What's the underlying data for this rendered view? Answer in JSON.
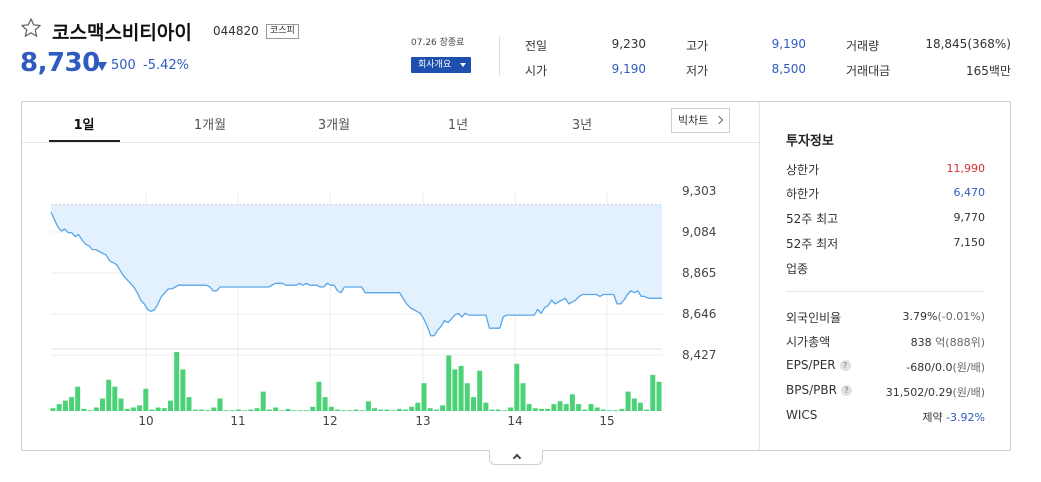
{
  "header": {
    "name": "코스맥스비티아이",
    "code": "044820",
    "market": "코스피",
    "price": "8,730",
    "change": "500",
    "change_pct": "-5.42%",
    "close_label": "07.26 장종료",
    "company_button": "회사개요"
  },
  "quote": {
    "prev_label": "전일",
    "prev_value": "9,230",
    "open_label": "시가",
    "open_value": "9,190",
    "high_label": "고가",
    "high_value": "9,190",
    "low_label": "저가",
    "low_value": "8,500",
    "volume_label": "거래량",
    "volume_value": "18,845(368%)",
    "amount_label": "거래대금",
    "amount_value": "165백만"
  },
  "tabs": [
    "1일",
    "1개월",
    "3개월",
    "1년",
    "3년"
  ],
  "big_chart_button": "빅차트",
  "chart_data": {
    "type": "line",
    "y_ticks": [
      "9,303",
      "9,084",
      "8,865",
      "8,646",
      "8,427"
    ],
    "ylim": [
      8427,
      9303
    ],
    "x_ticks": [
      "10",
      "11",
      "12",
      "13",
      "14",
      "15"
    ],
    "reference_line": 9230,
    "price_series": [
      9190,
      9150,
      9110,
      9090,
      9100,
      9080,
      9080,
      9060,
      9070,
      9040,
      9020,
      9010,
      8990,
      8990,
      8980,
      8970,
      8960,
      8930,
      8920,
      8910,
      8880,
      8850,
      8830,
      8810,
      8790,
      8760,
      8720,
      8700,
      8670,
      8660,
      8670,
      8700,
      8740,
      8760,
      8780,
      8780,
      8790,
      8800,
      8800,
      8800,
      8800,
      8800,
      8800,
      8800,
      8800,
      8800,
      8790,
      8770,
      8770,
      8790,
      8790,
      8790,
      8790,
      8790,
      8790,
      8790,
      8790,
      8790,
      8790,
      8790,
      8790,
      8790,
      8790,
      8790,
      8800,
      8810,
      8810,
      8810,
      8800,
      8800,
      8800,
      8800,
      8810,
      8800,
      8810,
      8800,
      8800,
      8800,
      8790,
      8790,
      8810,
      8800,
      8800,
      8770,
      8760,
      8790,
      8790,
      8790,
      8790,
      8790,
      8790,
      8760,
      8760,
      8760,
      8760,
      8760,
      8760,
      8760,
      8760,
      8760,
      8760,
      8760,
      8730,
      8700,
      8680,
      8670,
      8660,
      8650,
      8620,
      8580,
      8530,
      8530,
      8560,
      8580,
      8610,
      8600,
      8620,
      8640,
      8650,
      8630,
      8650,
      8640,
      8640,
      8640,
      8640,
      8640,
      8640,
      8570,
      8570,
      8570,
      8570,
      8630,
      8640,
      8640,
      8640,
      8640,
      8640,
      8640,
      8640,
      8640,
      8640,
      8670,
      8650,
      8680,
      8690,
      8720,
      8700,
      8710,
      8720,
      8730,
      8700,
      8710,
      8720,
      8740,
      8750,
      8750,
      8750,
      8750,
      8750,
      8740,
      8750,
      8750,
      8750,
      8750,
      8700,
      8700,
      8720,
      8750,
      8770,
      8760,
      8770,
      8740,
      8740,
      8730,
      8730,
      8730,
      8730,
      8730
    ],
    "volume_series": [
      4,
      10,
      15,
      20,
      35,
      3,
      1,
      5,
      18,
      45,
      35,
      18,
      3,
      5,
      8,
      32,
      2,
      5,
      4,
      15,
      85,
      60,
      20,
      2,
      2,
      1,
      5,
      18,
      1,
      1,
      2,
      1,
      2,
      4,
      28,
      2,
      5,
      1,
      3,
      1,
      1,
      1,
      6,
      42,
      20,
      6,
      2,
      1,
      1,
      2,
      1,
      14,
      4,
      2,
      2,
      1,
      3,
      2,
      6,
      12,
      40,
      4,
      2,
      8,
      80,
      60,
      65,
      40,
      20,
      58,
      12,
      2,
      2,
      1,
      5,
      68,
      40,
      10,
      4,
      3,
      3,
      10,
      14,
      10,
      24,
      10,
      2,
      10,
      5,
      2,
      1,
      1,
      3,
      28,
      18,
      12,
      2,
      52,
      42
    ],
    "volume_x_start": 52,
    "volume_x_end": 658
  },
  "info": {
    "title": "투자정보",
    "upper_label": "상한가",
    "upper_value": "11,990",
    "lower_label": "하한가",
    "lower_value": "6,470",
    "high52_label": "52주 최고",
    "high52_value": "9,770",
    "low52_label": "52주 최저",
    "low52_value": "7,150",
    "industry_label": "업종",
    "foreign_label": "외국인비율",
    "foreign_value": "3.79%",
    "foreign_sub": "(-0.01%)",
    "mcap_label": "시가총액",
    "mcap_value": "838",
    "mcap_sub": "억(888위)",
    "eps_label": "EPS/PER",
    "eps_value": "-680/0.0",
    "eps_sub": "(원/배)",
    "bps_label": "BPS/PBR",
    "bps_value": "31,502/0.29",
    "bps_sub": "(원/배)",
    "wics_label": "WICS",
    "wics_value": "제약",
    "wics_sub": "-3.92%"
  },
  "colors": {
    "accent_blue": "#2f5bc1",
    "up_red": "#d32f2f",
    "line": "#5aa6e8",
    "area": "#e3f0fd",
    "volume": "#4cd276"
  }
}
